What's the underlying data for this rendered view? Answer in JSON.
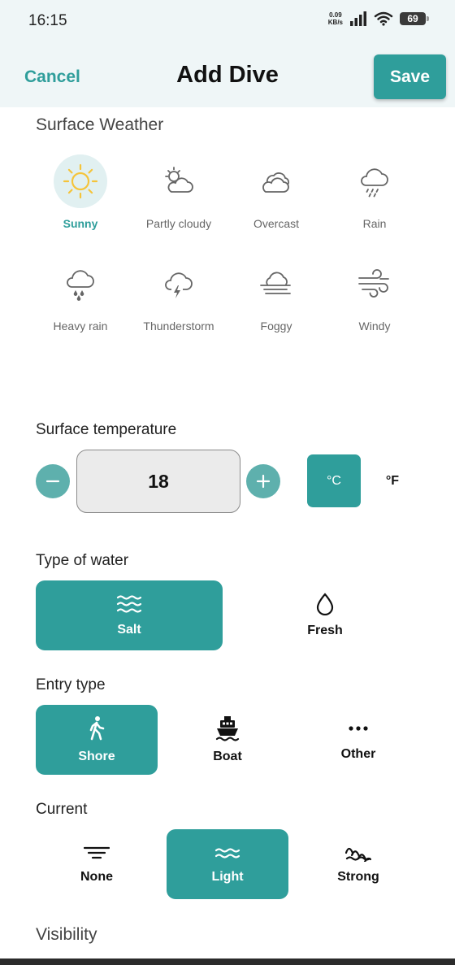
{
  "status": {
    "time": "16:15",
    "net_speed": "0.09",
    "net_unit": "KB/s",
    "battery": "69"
  },
  "header": {
    "cancel": "Cancel",
    "title": "Add Dive",
    "save": "Save"
  },
  "surface_weather": {
    "title": "Surface Weather",
    "options": [
      {
        "label": "Sunny",
        "icon": "sun-icon",
        "selected": true
      },
      {
        "label": "Partly cloudy",
        "icon": "partly-cloudy-icon",
        "selected": false
      },
      {
        "label": "Overcast",
        "icon": "overcast-icon",
        "selected": false
      },
      {
        "label": "Rain",
        "icon": "rain-icon",
        "selected": false
      },
      {
        "label": "Heavy rain",
        "icon": "heavy-rain-icon",
        "selected": false
      },
      {
        "label": "Thunderstorm",
        "icon": "thunderstorm-icon",
        "selected": false
      },
      {
        "label": "Foggy",
        "icon": "fog-icon",
        "selected": false
      },
      {
        "label": "Windy",
        "icon": "wind-icon",
        "selected": false
      }
    ]
  },
  "surface_temperature": {
    "title": "Surface temperature",
    "value": "18",
    "unit_c": "°C",
    "unit_f": "°F",
    "selected_unit": "°C"
  },
  "water_type": {
    "title": "Type of water",
    "options": [
      {
        "label": "Salt",
        "selected": true
      },
      {
        "label": "Fresh",
        "selected": false
      }
    ]
  },
  "entry_type": {
    "title": "Entry type",
    "options": [
      {
        "label": "Shore",
        "selected": true
      },
      {
        "label": "Boat",
        "selected": false
      },
      {
        "label": "Other",
        "selected": false
      }
    ]
  },
  "current": {
    "title": "Current",
    "options": [
      {
        "label": "None",
        "selected": false
      },
      {
        "label": "Light",
        "selected": true
      },
      {
        "label": "Strong",
        "selected": false
      }
    ]
  },
  "visibility": {
    "title": "Visibility"
  },
  "colors": {
    "accent": "#2f9e9b",
    "accent_light": "#e1f0f1",
    "header_bg": "#eff6f7",
    "sun": "#f5c43a"
  }
}
